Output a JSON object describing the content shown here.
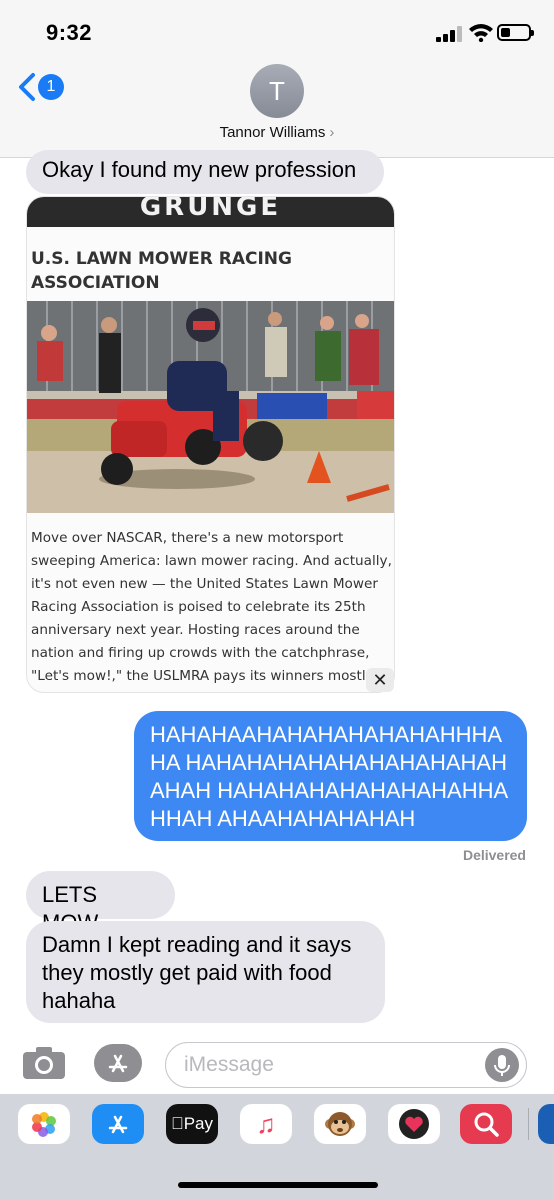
{
  "status_bar": {
    "time": "9:32",
    "battery_level": 0.35
  },
  "header": {
    "back_badge": "1",
    "avatar_initial": "T",
    "contact_name": "Tannor Williams",
    "chevron": "›"
  },
  "messages": {
    "m1": "Okay I found my new profession",
    "m2": "HAHAHAAHAHAHAHAHAHAHHHAHA HAHAHAHAHAHAHAHAHAHAHAHAH HAHAHAHAHAHAHAHAHHAHHAH AHAAHAHAHAHAH",
    "m3": "LETS MOW",
    "m4": "Damn I kept reading and it says they mostly get paid with food hahaha",
    "delivered": "Delivered"
  },
  "link_card": {
    "banner": "GRUNGE",
    "title": "U.S. LAWN MOWER RACING ASSOCIATION",
    "body": "Move over NASCAR, there's a new motorsport sweeping America: lawn mower racing. And actually, it's not even new — the United States Lawn Mower Racing Association is poised to celebrate its 25th anniversary next year. Hosting races around the nation and firing up crowds with the catchphrase, \"Let's mow!,\" the USLMRA pays its winners mostly",
    "close": "✕"
  },
  "compose": {
    "placeholder": "iMessage"
  },
  "drawer": {
    "apple_pay_label": "Pay"
  },
  "colors": {
    "outgoing": "#3d88f2",
    "incoming": "#e6e5eb",
    "accent": "#1a7cf5"
  }
}
